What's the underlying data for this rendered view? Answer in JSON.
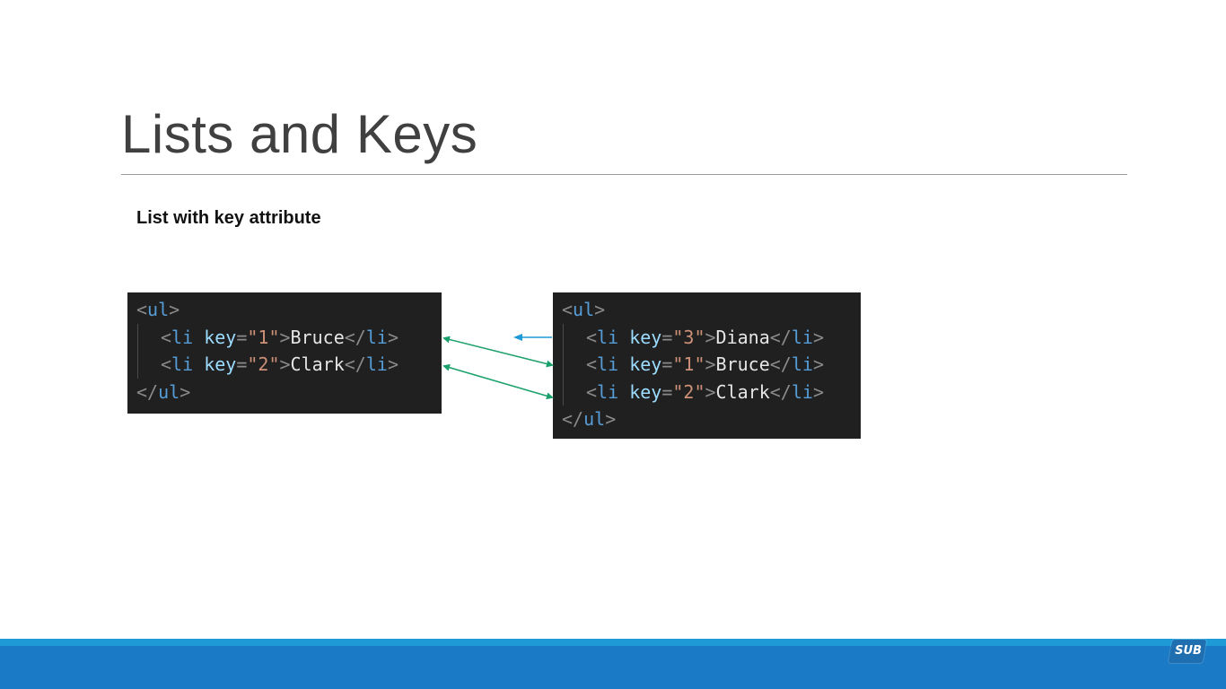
{
  "slide": {
    "title": "Lists and Keys",
    "subheading": "List with key attribute"
  },
  "left_code": {
    "lines": [
      {
        "indent": false,
        "tokens": [
          {
            "t": "<",
            "c": "punc"
          },
          {
            "t": "ul",
            "c": "tag"
          },
          {
            "t": ">",
            "c": "punc"
          }
        ]
      },
      {
        "indent": true,
        "tokens": [
          {
            "t": "<",
            "c": "punc"
          },
          {
            "t": "li",
            "c": "tag"
          },
          {
            "t": " ",
            "c": "text"
          },
          {
            "t": "key",
            "c": "attr"
          },
          {
            "t": "=",
            "c": "punc"
          },
          {
            "t": "\"1\"",
            "c": "str"
          },
          {
            "t": ">",
            "c": "punc"
          },
          {
            "t": "Bruce",
            "c": "text"
          },
          {
            "t": "</",
            "c": "punc"
          },
          {
            "t": "li",
            "c": "tag"
          },
          {
            "t": ">",
            "c": "punc"
          }
        ]
      },
      {
        "indent": true,
        "tokens": [
          {
            "t": "<",
            "c": "punc"
          },
          {
            "t": "li",
            "c": "tag"
          },
          {
            "t": " ",
            "c": "text"
          },
          {
            "t": "key",
            "c": "attr"
          },
          {
            "t": "=",
            "c": "punc"
          },
          {
            "t": "\"2\"",
            "c": "str"
          },
          {
            "t": ">",
            "c": "punc"
          },
          {
            "t": "Clark",
            "c": "text"
          },
          {
            "t": "</",
            "c": "punc"
          },
          {
            "t": "li",
            "c": "tag"
          },
          {
            "t": ">",
            "c": "punc"
          }
        ]
      },
      {
        "indent": false,
        "tokens": [
          {
            "t": "</",
            "c": "punc"
          },
          {
            "t": "ul",
            "c": "tag"
          },
          {
            "t": ">",
            "c": "punc"
          }
        ]
      }
    ]
  },
  "right_code": {
    "lines": [
      {
        "indent": false,
        "tokens": [
          {
            "t": "<",
            "c": "punc"
          },
          {
            "t": "ul",
            "c": "tag"
          },
          {
            "t": ">",
            "c": "punc"
          }
        ]
      },
      {
        "indent": true,
        "tokens": [
          {
            "t": "<",
            "c": "punc"
          },
          {
            "t": "li",
            "c": "tag"
          },
          {
            "t": " ",
            "c": "text"
          },
          {
            "t": "key",
            "c": "attr"
          },
          {
            "t": "=",
            "c": "punc"
          },
          {
            "t": "\"3\"",
            "c": "str"
          },
          {
            "t": ">",
            "c": "punc"
          },
          {
            "t": "Diana",
            "c": "text"
          },
          {
            "t": "</",
            "c": "punc"
          },
          {
            "t": "li",
            "c": "tag"
          },
          {
            "t": ">",
            "c": "punc"
          }
        ]
      },
      {
        "indent": true,
        "tokens": [
          {
            "t": "<",
            "c": "punc"
          },
          {
            "t": "li",
            "c": "tag"
          },
          {
            "t": " ",
            "c": "text"
          },
          {
            "t": "key",
            "c": "attr"
          },
          {
            "t": "=",
            "c": "punc"
          },
          {
            "t": "\"1\"",
            "c": "str"
          },
          {
            "t": ">",
            "c": "punc"
          },
          {
            "t": "Bruce",
            "c": "text"
          },
          {
            "t": "</",
            "c": "punc"
          },
          {
            "t": "li",
            "c": "tag"
          },
          {
            "t": ">",
            "c": "punc"
          }
        ]
      },
      {
        "indent": true,
        "tokens": [
          {
            "t": "<",
            "c": "punc"
          },
          {
            "t": "li",
            "c": "tag"
          },
          {
            "t": " ",
            "c": "text"
          },
          {
            "t": "key",
            "c": "attr"
          },
          {
            "t": "=",
            "c": "punc"
          },
          {
            "t": "\"2\"",
            "c": "str"
          },
          {
            "t": ">",
            "c": "punc"
          },
          {
            "t": "Clark",
            "c": "text"
          },
          {
            "t": "</",
            "c": "punc"
          },
          {
            "t": "li",
            "c": "tag"
          },
          {
            "t": ">",
            "c": "punc"
          }
        ]
      },
      {
        "indent": false,
        "tokens": [
          {
            "t": "</",
            "c": "punc"
          },
          {
            "t": "ul",
            "c": "tag"
          },
          {
            "t": ">",
            "c": "punc"
          }
        ]
      }
    ]
  },
  "arrows": {
    "match_color": "#1aa06a",
    "new_item_color": "#1e9ad6"
  },
  "colors": {
    "code_background": "#202020",
    "footer_bar": "#1b7ac6",
    "footer_accent": "#1e9ad6",
    "title_text": "#404040"
  },
  "footer": {
    "logo_text": "SUB"
  }
}
